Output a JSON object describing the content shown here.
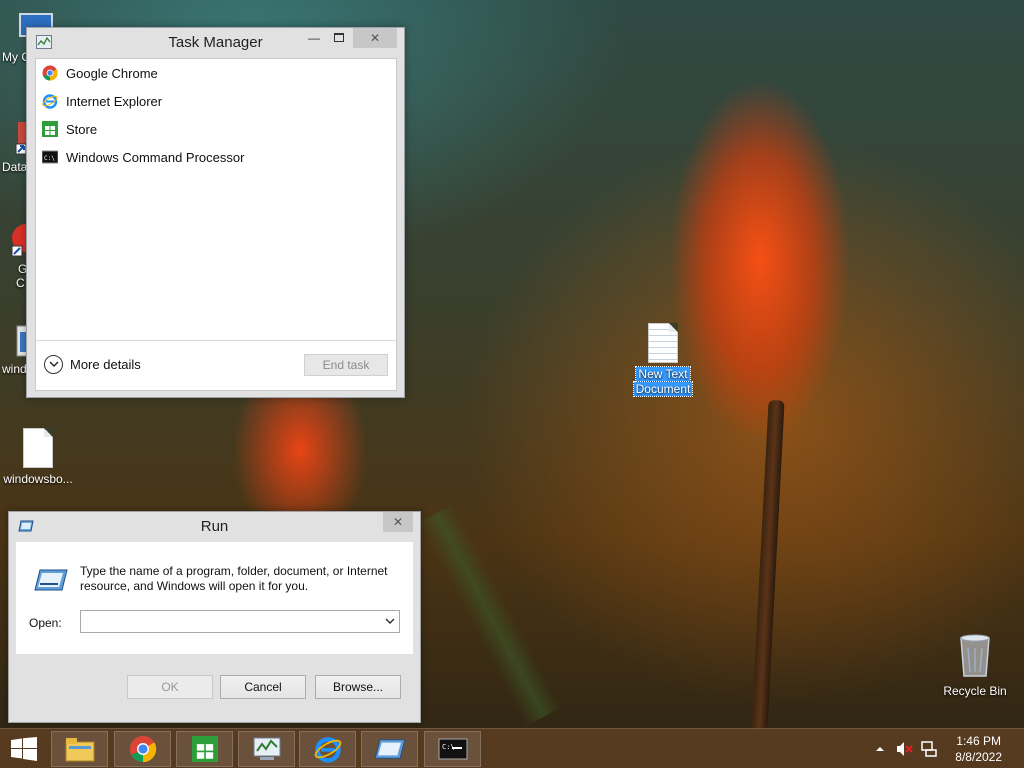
{
  "desktop": {
    "icons": [
      {
        "label": "My C",
        "icon": "computer-icon"
      },
      {
        "label": "Data",
        "icon": "database-shortcut-icon"
      },
      {
        "label": "G",
        "label2": "C",
        "icon": "chrome-shortcut-icon"
      },
      {
        "label": "windo",
        "icon": "window-app-icon"
      },
      {
        "label": "windowsbo...",
        "icon": "text-file-icon"
      },
      {
        "label": "New Text Document",
        "line1": "New Text",
        "line2": "Document",
        "icon": "text-file-icon"
      },
      {
        "label": "Recycle Bin",
        "icon": "recycle-bin-icon"
      }
    ]
  },
  "task_manager": {
    "title": "Task Manager",
    "apps": [
      {
        "name": "Google Chrome",
        "icon": "chrome-icon"
      },
      {
        "name": "Internet Explorer",
        "icon": "ie-icon"
      },
      {
        "name": "Store",
        "icon": "store-icon"
      },
      {
        "name": "Windows Command Processor",
        "icon": "cmd-icon"
      }
    ],
    "more_details": "More details",
    "end_task": "End task"
  },
  "run_dialog": {
    "title": "Run",
    "description": "Type the name of a program, folder, document, or Internet resource, and Windows will open it for you.",
    "open_label": "Open:",
    "open_value": "",
    "ok": "OK",
    "cancel": "Cancel",
    "browse": "Browse..."
  },
  "taskbar": {
    "apps": [
      "file-explorer-icon",
      "chrome-icon",
      "store-icon",
      "task-manager-icon",
      "ie-icon",
      "run-icon",
      "cmd-icon"
    ],
    "time": "1:46 PM",
    "date": "8/8/2022"
  },
  "colors": {
    "selection": "#3399ff",
    "taskbar": "#5c3e22"
  }
}
